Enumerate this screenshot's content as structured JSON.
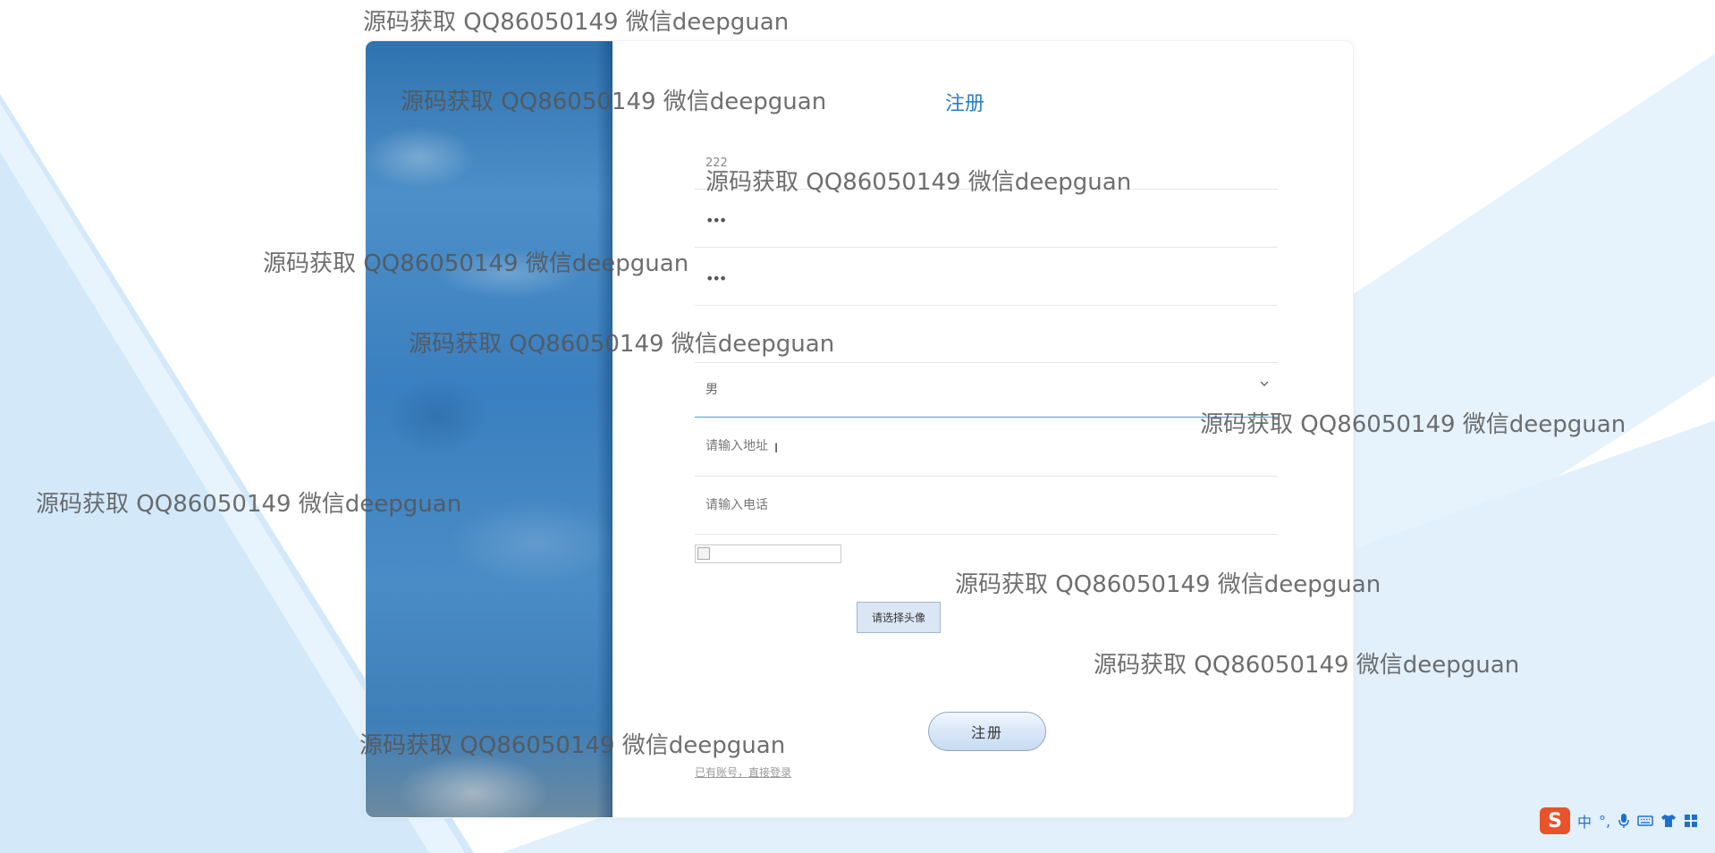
{
  "watermark": "源码获取 QQ86050149 微信deepguan",
  "form": {
    "title": "注册",
    "username_value": "222",
    "password_value": "•••",
    "confirm_password_value": "•••",
    "nickname_value": "",
    "sex_options": [
      "男"
    ],
    "sex_selected": "男",
    "address_placeholder": "请输入地址",
    "phone_placeholder": "请输入电话",
    "pick_avatar_label": "请选择头像",
    "submit_label": "注册",
    "login_link": "已有账号，直接登录"
  },
  "tray": {
    "logo": "S",
    "ime_mode": "中",
    "punct": "°,",
    "icons": [
      "microphone-icon",
      "keyboard-icon",
      "shirt-icon",
      "grid-icon"
    ]
  },
  "colors": {
    "accent": "#2c7fc4",
    "background_shape": "#d7ebfa",
    "focus_line": "#4a9ec9",
    "side_image": "#3a7fbf"
  }
}
